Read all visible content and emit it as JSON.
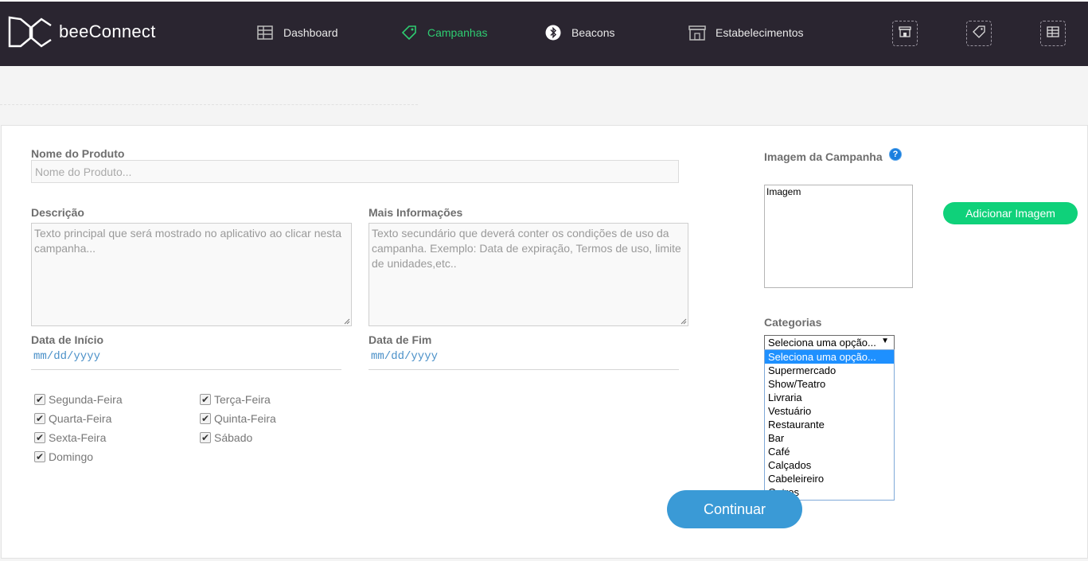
{
  "brand": {
    "name": "beeConnect"
  },
  "nav": {
    "dashboard": "Dashboard",
    "campanhas": "Campanhas",
    "beacons": "Beacons",
    "estabelecimentos": "Estabelecimentos"
  },
  "colors": {
    "topbar": "#2a2530",
    "active_nav": "#2ecc71",
    "accent_green": "#0fd17a",
    "accent_blue": "#3a9ad6"
  },
  "form": {
    "nome_label": "Nome do Produto",
    "nome_placeholder": "Nome do Produto...",
    "descricao_label": "Descrição",
    "descricao_placeholder": "Texto principal que será mostrado no aplicativo ao clicar nesta campanha...",
    "mais_label": "Mais Informações",
    "mais_placeholder": "Texto secundário que deverá conter os condições de uso da campanha. Exemplo: Data de expiração, Termos de uso, limite de unidades,etc..",
    "inicio_label": "Data de Início",
    "inicio_value": "mm/dd/yyyy",
    "fim_label": "Data de Fim",
    "fim_value": "mm/dd/yyyy",
    "days": [
      "Segunda-Feira",
      "Terça-Feira",
      "Quarta-Feira",
      "Quinta-Feira",
      "Sexta-Feira",
      "Sábado",
      "Domingo"
    ]
  },
  "side": {
    "imagem_label": "Imagem da Campanha",
    "imagem_box": "Imagem",
    "add_button": "Adicionar Imagem",
    "categorias_label": "Categorias",
    "select_value": "Seleciona uma opção...",
    "options": [
      "Seleciona uma opção...",
      "Supermercado",
      "Show/Teatro",
      "Livraria",
      "Vestuário",
      "Restaurante",
      "Bar",
      "Café",
      "Calçados",
      "Cabeleireiro",
      "Outros"
    ]
  },
  "continue_button": "Continuar"
}
